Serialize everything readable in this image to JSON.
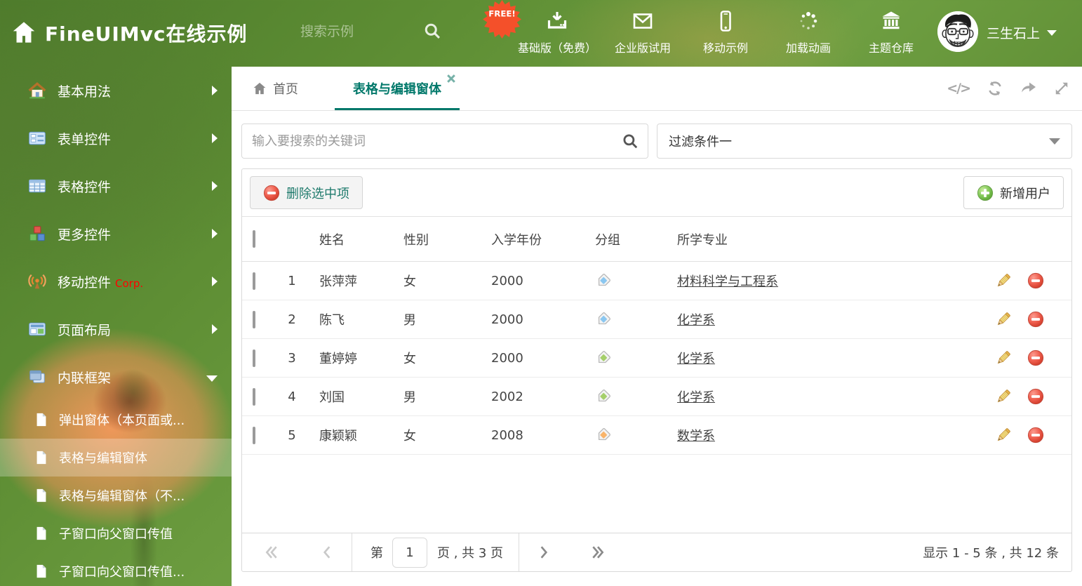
{
  "topbar": {
    "title": "FineUIMvc在线示例",
    "search_placeholder": "搜索示例",
    "free_badge": "FREE!",
    "nav_items": [
      {
        "label": "基础版（免费）",
        "icon": "download"
      },
      {
        "label": "企业版试用",
        "icon": "envelope"
      },
      {
        "label": "移动示例",
        "icon": "mobile"
      },
      {
        "label": "加载动画",
        "icon": "spinner"
      },
      {
        "label": "主题仓库",
        "icon": "bank"
      }
    ],
    "username": "三生石上"
  },
  "sidebar": {
    "items": [
      {
        "label": "基本用法",
        "icon": "home"
      },
      {
        "label": "表单控件",
        "icon": "form"
      },
      {
        "label": "表格控件",
        "icon": "table"
      },
      {
        "label": "更多控件",
        "icon": "cubes"
      },
      {
        "label": "移动控件",
        "icon": "antenna",
        "badge": "Corp."
      },
      {
        "label": "页面布局",
        "icon": "layout"
      },
      {
        "label": "内联框架",
        "icon": "frames",
        "expanded": true
      }
    ],
    "subitems": [
      {
        "label": "弹出窗体（本页面或..."
      },
      {
        "label": "表格与编辑窗体",
        "active": true
      },
      {
        "label": "表格与编辑窗体（不..."
      },
      {
        "label": "子窗口向父窗口传值"
      },
      {
        "label": "子窗口向父窗口传值..."
      }
    ]
  },
  "tabs": {
    "home_label": "首页",
    "active_label": "表格与编辑窗体"
  },
  "search_row": {
    "input_placeholder": "输入要搜索的关键词",
    "filter_value": "过滤条件一"
  },
  "toolbar": {
    "delete_label": "删除选中项",
    "add_label": "新增用户"
  },
  "grid": {
    "columns": [
      "姓名",
      "性别",
      "入学年份",
      "分组",
      "所学专业"
    ],
    "tag_colors": {
      "blue": "#8bc7f0",
      "green": "#a5cf6b",
      "orange": "#f9b46a"
    },
    "rows": [
      {
        "num": "1",
        "name": "张萍萍",
        "gender": "女",
        "year": "2000",
        "tag": "blue",
        "major": "材料科学与工程系"
      },
      {
        "num": "2",
        "name": "陈飞",
        "gender": "男",
        "year": "2000",
        "tag": "blue",
        "major": "化学系"
      },
      {
        "num": "3",
        "name": "董婷婷",
        "gender": "女",
        "year": "2000",
        "tag": "green",
        "major": "化学系"
      },
      {
        "num": "4",
        "name": "刘国",
        "gender": "男",
        "year": "2002",
        "tag": "green",
        "major": "化学系"
      },
      {
        "num": "5",
        "name": "康颖颖",
        "gender": "女",
        "year": "2008",
        "tag": "orange",
        "major": "数学系"
      }
    ]
  },
  "pagination": {
    "page_prefix": "第",
    "page_value": "1",
    "page_suffix": "页 , 共 3 页",
    "summary": "显示 1 - 5 条 , 共 12 条"
  },
  "colors": {
    "accent": "#00786a",
    "topbar_green": "#5e8e34",
    "free_badge": "#f4502a",
    "link": "#444444"
  }
}
